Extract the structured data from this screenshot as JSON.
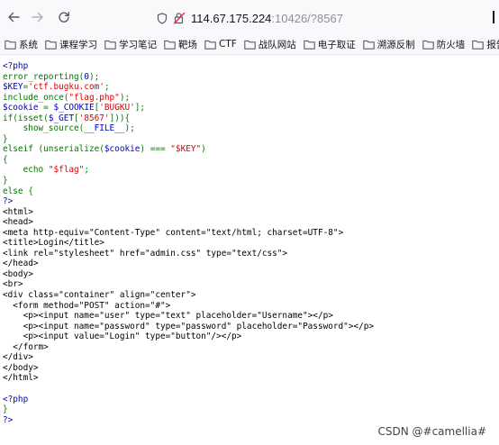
{
  "browser": {
    "url_host": "114.67.175.224",
    "url_rest": ":10426/?8567",
    "bookmarks": [
      "系统",
      "课程学习",
      "学习笔记",
      "靶场",
      "CTF",
      "战队网站",
      "电子取证",
      "溯源反制",
      "防火墙",
      "报告书"
    ]
  },
  "source": {
    "lines": [
      [
        {
          "t": "<?php",
          "c": "tag"
        }
      ],
      [
        {
          "t": "error_reporting(",
          "c": "fn"
        },
        {
          "t": "0",
          "c": "var"
        },
        {
          "t": ");",
          "c": "fn"
        }
      ],
      [
        {
          "t": "$KEY",
          "c": "var"
        },
        {
          "t": "=",
          "c": "fn"
        },
        {
          "t": "'ctf.bugku.com'",
          "c": "str"
        },
        {
          "t": ";",
          "c": "fn"
        }
      ],
      [
        {
          "t": "include_once(",
          "c": "fn"
        },
        {
          "t": "\"flag.php\"",
          "c": "str"
        },
        {
          "t": ");",
          "c": "fn"
        }
      ],
      [
        {
          "t": "$cookie ",
          "c": "var"
        },
        {
          "t": "= ",
          "c": "fn"
        },
        {
          "t": "$_COOKIE",
          "c": "var"
        },
        {
          "t": "[",
          "c": "fn"
        },
        {
          "t": "'BUGKU'",
          "c": "str"
        },
        {
          "t": "];",
          "c": "fn"
        }
      ],
      [
        {
          "t": "if(isset(",
          "c": "fn"
        },
        {
          "t": "$_GET",
          "c": "var"
        },
        {
          "t": "[",
          "c": "fn"
        },
        {
          "t": "'8567'",
          "c": "str"
        },
        {
          "t": "])){",
          "c": "fn"
        }
      ],
      [
        {
          "t": "    show_source(",
          "c": "fn"
        },
        {
          "t": "__FILE__",
          "c": "var"
        },
        {
          "t": ");",
          "c": "fn"
        }
      ],
      [
        {
          "t": "}",
          "c": "fn"
        }
      ],
      [
        {
          "t": "elseif (unserialize(",
          "c": "fn"
        },
        {
          "t": "$cookie",
          "c": "var"
        },
        {
          "t": ") === ",
          "c": "fn"
        },
        {
          "t": "\"$KEY\"",
          "c": "str"
        },
        {
          "t": ")",
          "c": "fn"
        }
      ],
      [
        {
          "t": "{",
          "c": "fn"
        }
      ],
      [
        {
          "t": "    echo ",
          "c": "fn"
        },
        {
          "t": "\"$flag\"",
          "c": "str"
        },
        {
          "t": ";",
          "c": "fn"
        }
      ],
      [
        {
          "t": "}",
          "c": "fn"
        }
      ],
      [
        {
          "t": "else {",
          "c": "fn"
        }
      ],
      [
        {
          "t": "?>",
          "c": "tag"
        }
      ],
      [
        {
          "t": "<html>",
          "c": "html"
        }
      ],
      [
        {
          "t": "<head>",
          "c": "html"
        }
      ],
      [
        {
          "t": "<meta http-equiv=\"Content-Type\" content=\"text/html; charset=UTF-8\">",
          "c": "html"
        }
      ],
      [
        {
          "t": "<title>Login</title>",
          "c": "html"
        }
      ],
      [
        {
          "t": "<link rel=\"stylesheet\" href=\"admin.css\" type=\"text/css\">",
          "c": "html"
        }
      ],
      [
        {
          "t": "</head>",
          "c": "html"
        }
      ],
      [
        {
          "t": "<body>",
          "c": "html"
        }
      ],
      [
        {
          "t": "<br>",
          "c": "html"
        }
      ],
      [
        {
          "t": "<div class=\"container\" align=\"center\">",
          "c": "html"
        }
      ],
      [
        {
          "t": "  <form method=\"POST\" action=\"#\">",
          "c": "html"
        }
      ],
      [
        {
          "t": "    <p><input name=\"user\" type=\"text\" placeholder=\"Username\"></p>",
          "c": "html"
        }
      ],
      [
        {
          "t": "    <p><input name=\"password\" type=\"password\" placeholder=\"Password\"></p>",
          "c": "html"
        }
      ],
      [
        {
          "t": "    <p><input value=\"Login\" type=\"button\"/></p>",
          "c": "html"
        }
      ],
      [
        {
          "t": "  </form>",
          "c": "html"
        }
      ],
      [
        {
          "t": "</div>",
          "c": "html"
        }
      ],
      [
        {
          "t": "</body>",
          "c": "html"
        }
      ],
      [
        {
          "t": "</html>",
          "c": "html"
        }
      ],
      [
        {
          "t": "",
          "c": "html"
        }
      ],
      [
        {
          "t": "<?php",
          "c": "tag"
        }
      ],
      [
        {
          "t": "}",
          "c": "fn"
        }
      ],
      [
        {
          "t": "?>",
          "c": "tag"
        }
      ]
    ]
  },
  "watermark": "CSDN @#camellia#",
  "colors": {
    "php_tag": "#0000bb",
    "php_default": "#007700",
    "php_string": "#dd0000",
    "html": "#000000"
  },
  "icons": [
    "back-arrow-icon",
    "forward-arrow-icon",
    "reload-icon",
    "shield-icon",
    "insecure-lock-icon",
    "folder-icon"
  ]
}
